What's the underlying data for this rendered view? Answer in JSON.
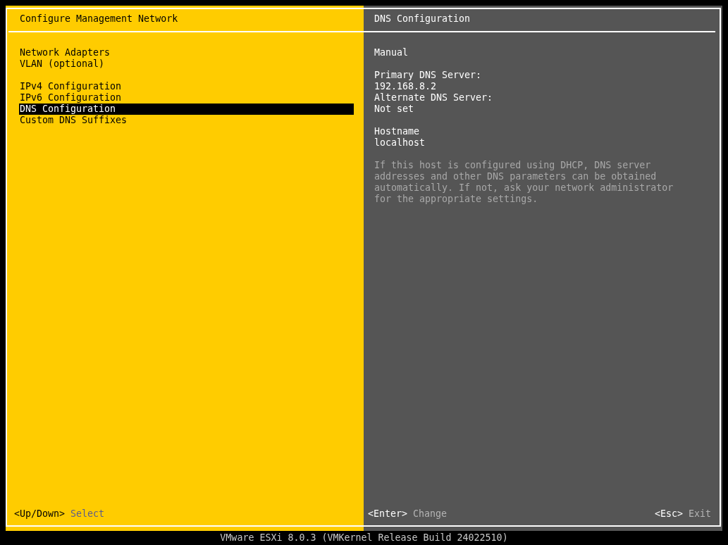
{
  "left_panel": {
    "title": "Configure Management Network",
    "menu_groups": [
      {
        "items": [
          {
            "label": "Network Adapters",
            "selected": false
          },
          {
            "label": "VLAN (optional)",
            "selected": false
          }
        ]
      },
      {
        "items": [
          {
            "label": "IPv4 Configuration",
            "selected": false
          },
          {
            "label": "IPv6 Configuration",
            "selected": false
          },
          {
            "label": "DNS Configuration",
            "selected": true
          },
          {
            "label": "Custom DNS Suffixes",
            "selected": false
          }
        ]
      }
    ],
    "hints": [
      {
        "key": "<Up/Down>",
        "action": "Select"
      }
    ]
  },
  "right_panel": {
    "title": "DNS Configuration",
    "groups": [
      {
        "lines": [
          "Manual"
        ]
      },
      {
        "lines": [
          "Primary DNS Server:",
          "192.168.8.2",
          "Alternate DNS Server:",
          "Not set"
        ]
      },
      {
        "lines": [
          "Hostname",
          "localhost"
        ]
      }
    ],
    "help_text": "If this host is configured using DHCP, DNS server addresses and other DNS parameters can be obtained automatically. If not, ask your network administrator for the appropriate settings.",
    "hints": [
      {
        "key": "<Enter>",
        "action": "Change"
      }
    ],
    "exit_hint": {
      "key": "<Esc>",
      "action": "Exit"
    }
  },
  "status_bar": "VMware ESXi 8.0.3 (VMKernel Release Build 24022510)"
}
